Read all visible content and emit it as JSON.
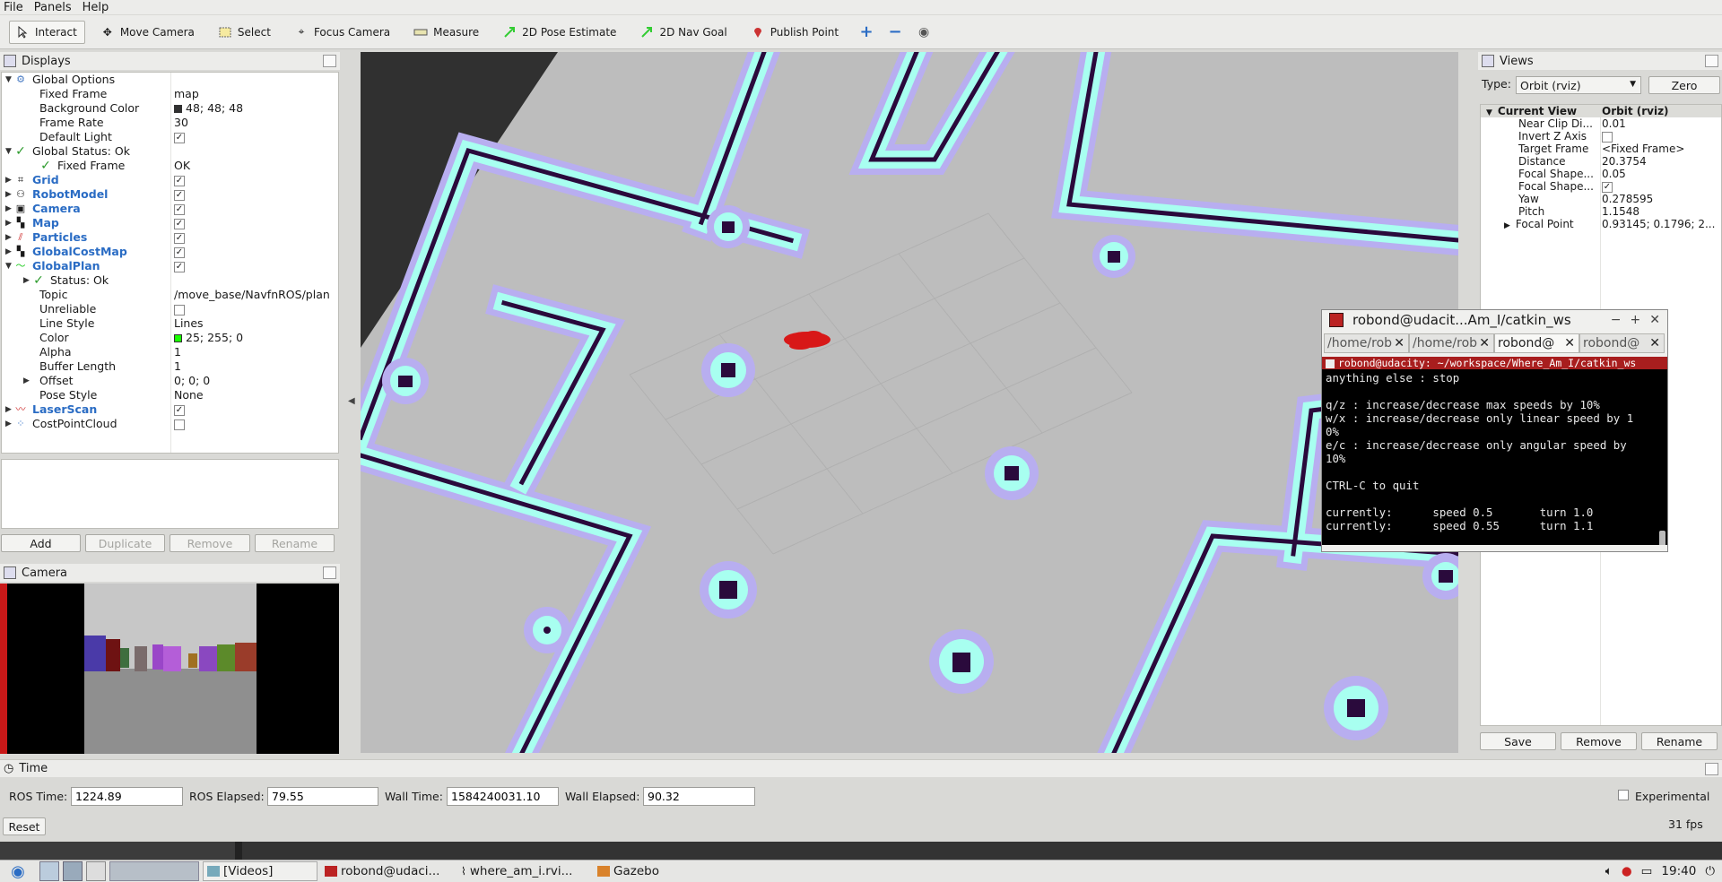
{
  "menu": {
    "file": "File",
    "panels": "Panels",
    "help": "Help"
  },
  "toolbar": {
    "interact": "Interact",
    "move_camera": "Move Camera",
    "select": "Select",
    "focus_camera": "Focus Camera",
    "measure": "Measure",
    "pose_estimate": "2D Pose Estimate",
    "nav_goal": "2D Nav Goal",
    "publish_point": "Publish Point"
  },
  "displays": {
    "title": "Displays",
    "global_options": "Global Options",
    "fixed_frame_label": "Fixed Frame",
    "fixed_frame_value": "map",
    "bg_label": "Background Color",
    "bg_value": "48; 48; 48",
    "frame_rate_label": "Frame Rate",
    "frame_rate_value": "30",
    "default_light_label": "Default Light",
    "global_status": "Global Status: Ok",
    "gs_fixed_frame_label": "Fixed Frame",
    "gs_fixed_frame_value": "OK",
    "grid": "Grid",
    "robot_model": "RobotModel",
    "camera": "Camera",
    "map": "Map",
    "particles": "Particles",
    "global_costmap": "GlobalCostMap",
    "global_plan": "GlobalPlan",
    "gp_status": "Status: Ok",
    "topic_label": "Topic",
    "topic_value": "/move_base/NavfnROS/plan",
    "unreliable_label": "Unreliable",
    "line_style_label": "Line Style",
    "line_style_value": "Lines",
    "color_label": "Color",
    "color_value": "25; 255; 0",
    "alpha_label": "Alpha",
    "alpha_value": "1",
    "buffer_label": "Buffer Length",
    "buffer_value": "1",
    "offset_label": "Offset",
    "offset_value": "0; 0; 0",
    "pose_style_label": "Pose Style",
    "pose_style_value": "None",
    "laser_scan": "LaserScan",
    "cost_point_cloud": "CostPointCloud",
    "buttons": {
      "add": "Add",
      "duplicate": "Duplicate",
      "remove": "Remove",
      "rename": "Rename"
    }
  },
  "camera_panel": {
    "title": "Camera"
  },
  "views": {
    "title": "Views",
    "type_label": "Type:",
    "type_value": "Orbit (rviz)",
    "zero": "Zero",
    "current_view": "Current View",
    "current_view_value": "Orbit (rviz)",
    "rows": [
      {
        "k": "Near Clip Di...",
        "v": "0.01"
      },
      {
        "k": "Invert Z Axis",
        "v": ""
      },
      {
        "k": "Target Frame",
        "v": "<Fixed Frame>"
      },
      {
        "k": "Distance",
        "v": "20.3754"
      },
      {
        "k": "Focal Shape...",
        "v": "0.05"
      },
      {
        "k": "Focal Shape...",
        "v": ""
      },
      {
        "k": "Yaw",
        "v": "0.278595"
      },
      {
        "k": "Pitch",
        "v": "1.1548"
      },
      {
        "k": "Focal Point",
        "v": "0.93145; 0.1796; 2..."
      }
    ],
    "save": "Save",
    "remove": "Remove",
    "rename": "Rename"
  },
  "terminal": {
    "title": "robond@udacit...Am_I/catkin_ws",
    "tabs": [
      "/home/rob",
      "/home/rob",
      "robond@",
      "robond@"
    ],
    "head": "robond@udacity: ~/workspace/Where_Am_I/catkin_ws",
    "lines": [
      "anything else : stop",
      "",
      "q/z : increase/decrease max speeds by 10%",
      "w/x : increase/decrease only linear speed by 1",
      "0%",
      "e/c : increase/decrease only angular speed by",
      "10%",
      "",
      "CTRL-C to quit",
      "",
      "currently:      speed 0.5       turn 1.0",
      "currently:      speed 0.55      turn 1.1"
    ]
  },
  "time": {
    "title": "Time",
    "ros_time_label": "ROS Time:",
    "ros_time": "1224.89",
    "ros_elapsed_label": "ROS Elapsed:",
    "ros_elapsed": "79.55",
    "wall_time_label": "Wall Time:",
    "wall_time": "1584240031.10",
    "wall_elapsed_label": "Wall Elapsed:",
    "wall_elapsed": "90.32",
    "experimental": "Experimental",
    "reset": "Reset",
    "fps": "31 fps"
  },
  "taskbar": {
    "videos": "[Videos]",
    "terminal": "robond@udaci...",
    "rviz": "where_am_i.rvi...",
    "gazebo": "Gazebo",
    "clock": "19:40"
  },
  "colors": {
    "accent": "#2a6cc4",
    "background": "#303030",
    "terminal_head": "#a81e1e"
  }
}
